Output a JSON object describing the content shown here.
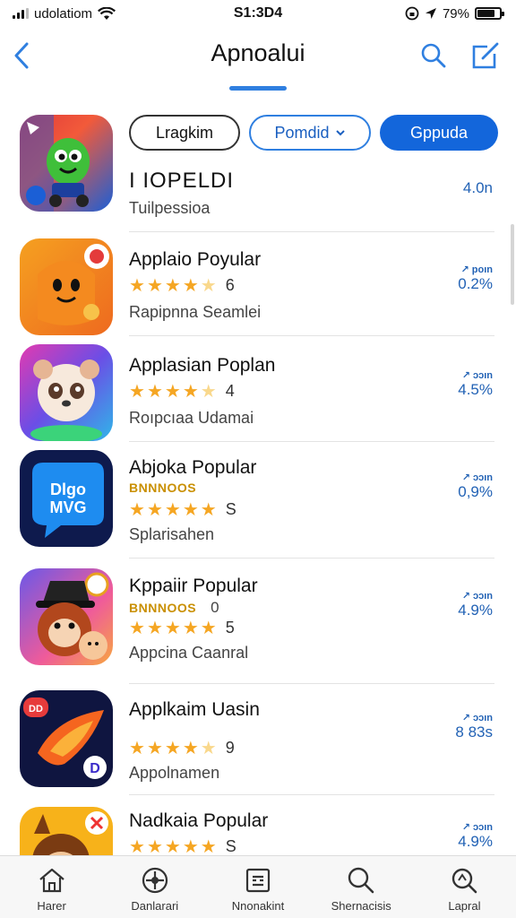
{
  "status_bar": {
    "carrier": "udolatiom",
    "time": "S1:3D4",
    "battery_percent_label": "79%",
    "battery_level": 0.79
  },
  "nav": {
    "title": "Apnoalui",
    "back_icon": "chevron-left-icon",
    "search_icon": "search-icon",
    "compose_icon": "compose-icon"
  },
  "filters": {
    "pill1": "Lragkim",
    "pill2": "Pomdid",
    "pill3": "Gppuda"
  },
  "apps": [
    {
      "name": "I IOPELDI",
      "tag": "",
      "stars": null,
      "rating_count": "",
      "subtitle": "Tuilpessioa",
      "meta_top": "",
      "meta_val": "4.0n"
    },
    {
      "name": "Applaio Poyular",
      "tag": "",
      "stars": 4.5,
      "rating_count": "6",
      "subtitle": "Rapipnna Seamlei",
      "meta_top": "↗ poın",
      "meta_val": "0.2%"
    },
    {
      "name": "Applasian Poplan",
      "tag": "",
      "stars": 4.5,
      "rating_count": "4",
      "subtitle": "Roıpcıaa Udamai",
      "meta_top": "↗ ɔɔın",
      "meta_val": "4.5%"
    },
    {
      "name": "Abjoka Popular",
      "tag": "BNNNOOS",
      "stars": 5,
      "rating_count": "S",
      "subtitle": "Splarisahen",
      "meta_top": "↗ ɔɔın",
      "meta_val": "0,9%"
    },
    {
      "name": "Kppaiir Popular",
      "tag": "BNNNOOS",
      "tag_count": "0",
      "stars": 5,
      "rating_count": "5",
      "subtitle": "Appcina Caanral",
      "meta_top": "↗ ɔɔın",
      "meta_val": "4.9%"
    },
    {
      "name": "Applkaim Uasin",
      "tag": "",
      "stars": 4.5,
      "rating_count": "9",
      "subtitle": "Appolnamen",
      "meta_top": "↗ ɔɔın",
      "meta_val": "8 83s"
    },
    {
      "name": "Nadkaia Popular",
      "tag": "",
      "stars": 5,
      "rating_count": "S",
      "subtitle": "",
      "meta_top": "↗ ɔɔın",
      "meta_val": "4.9%"
    }
  ],
  "tabs": [
    {
      "label": "Harer",
      "icon": "home-icon"
    },
    {
      "label": "Danlarari",
      "icon": "compass-icon"
    },
    {
      "label": "Nnonakint",
      "icon": "calculator-icon"
    },
    {
      "label": "Shernacisis",
      "icon": "search-icon"
    },
    {
      "label": "Lapral",
      "icon": "search-detail-icon"
    }
  ]
}
